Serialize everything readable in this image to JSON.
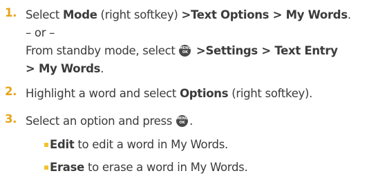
{
  "steps": [
    {
      "number": "1.",
      "lines": [
        {
          "pre": "Select ",
          "bold": "Mode",
          "post": " (right softkey) ",
          "bold2": ">Text Options > My Words",
          "end": "."
        },
        {
          "text": "– or –"
        },
        {
          "pre": "From standby mode, select ",
          "icon": "menu-ok-key-icon",
          "bold": " >Settings > Text Entry"
        },
        {
          "bold": "> My Words",
          "end": "."
        }
      ]
    },
    {
      "number": "2.",
      "pre": "Highlight a word and select ",
      "bold": "Options",
      "post": " (right softkey)."
    },
    {
      "number": "3.",
      "pre": "Select an option and press ",
      "icon": "menu-ok-key-icon",
      "end": "."
    }
  ],
  "menu_key": {
    "top": "MENU",
    "bottom": "OK"
  },
  "options": [
    {
      "bold": "Edit",
      "text": " to edit a word in My Words."
    },
    {
      "bold": "Erase",
      "text": " to erase a word in My Words."
    }
  ],
  "colors": {
    "number": "#e8a317",
    "bullet": "#f2c230",
    "text": "#3b3b3b"
  }
}
